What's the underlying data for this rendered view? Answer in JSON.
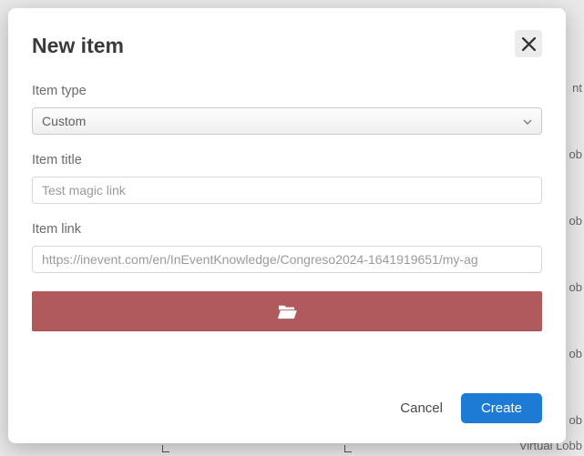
{
  "modal": {
    "title": "New item",
    "item_type": {
      "label": "Item type",
      "value": "Custom"
    },
    "item_title": {
      "label": "Item title",
      "placeholder": "Test magic link",
      "value": ""
    },
    "item_link": {
      "label": "Item link",
      "placeholder": "https://inevent.com/en/InEventKnowledge/Congreso2024-1641919651/my-ag",
      "value": ""
    },
    "footer": {
      "cancel": "Cancel",
      "create": "Create"
    }
  },
  "background": {
    "right_label": "Virtual Lobb"
  }
}
